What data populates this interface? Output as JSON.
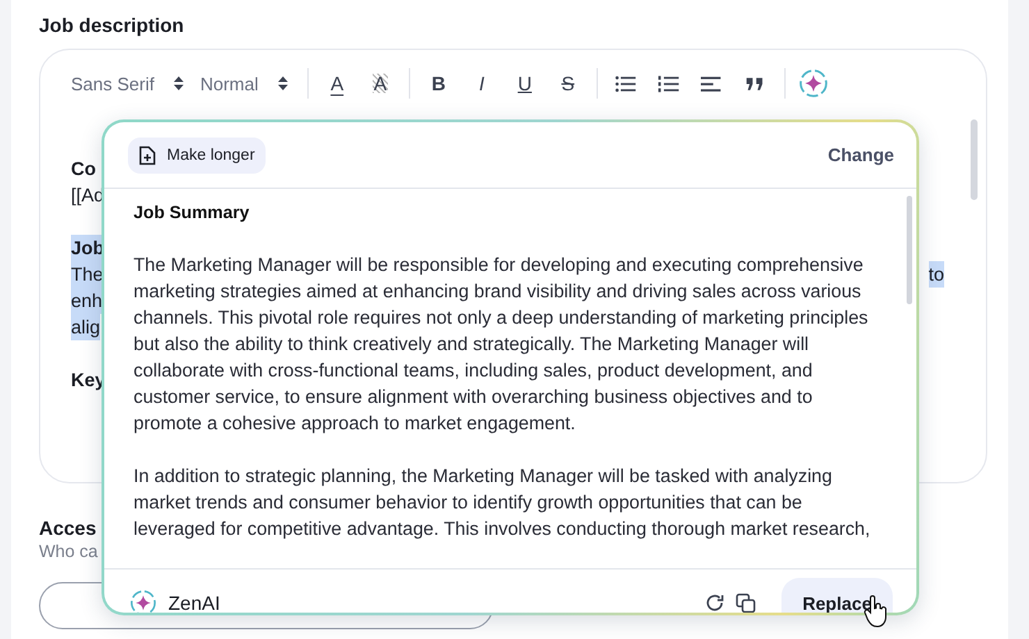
{
  "section_title": "Job description",
  "toolbar": {
    "font": "Sans Serif",
    "size": "Normal",
    "tools": [
      {
        "kind": "glyph",
        "label": "A"
      },
      {
        "kind": "glyph",
        "label": "A"
      },
      {
        "kind": "divider"
      },
      {
        "kind": "glyph",
        "label": "B"
      },
      {
        "kind": "glyph",
        "label": "I"
      },
      {
        "kind": "glyph",
        "label": "U"
      },
      {
        "kind": "glyph",
        "label": "S"
      },
      {
        "kind": "divider"
      },
      {
        "kind": "icon"
      },
      {
        "kind": "icon"
      },
      {
        "kind": "icon"
      },
      {
        "kind": "icon"
      },
      {
        "kind": "divider"
      },
      {
        "kind": "icon"
      }
    ]
  },
  "editor_blocks": [
    [
      {
        "text": "Co",
        "bold": true,
        "selected": false
      },
      {
        "text": "[[Ad",
        "bold": false,
        "selected": false
      }
    ],
    [
      {
        "text": "Job",
        "bold": true,
        "selected": true
      },
      {
        "text": "The",
        "bold": false,
        "selected": true,
        "right": "to"
      },
      {
        "text": "enh",
        "bold": false,
        "selected": true
      },
      {
        "text": "alig",
        "bold": false,
        "selected": true
      }
    ],
    [
      {
        "text": "Key",
        "bold": true,
        "selected": false
      }
    ]
  ],
  "access": {
    "title": "Acces",
    "subtitle": "Who ca"
  },
  "ai_panel": {
    "action": "Make longer",
    "change": "Change",
    "heading": "Job Summary",
    "paragraphs": [
      "The Marketing Manager will be responsible for developing and executing comprehensive marketing strategies aimed at enhancing brand visibility and driving sales across various channels. This pivotal role requires not only a deep understanding of marketing principles but also the ability to think creatively and strategically. The Marketing Manager will collaborate with cross-functional teams, including sales, product development, and customer service, to ensure alignment with overarching business objectives and to promote a cohesive approach to market engagement.",
      "In addition to strategic planning, the Marketing Manager will be tasked with analyzing market trends and consumer behavior to identify growth opportunities that can be leveraged for competitive advantage. This involves conducting thorough market research,"
    ],
    "brand": "ZenAI",
    "replace": "Replace"
  }
}
